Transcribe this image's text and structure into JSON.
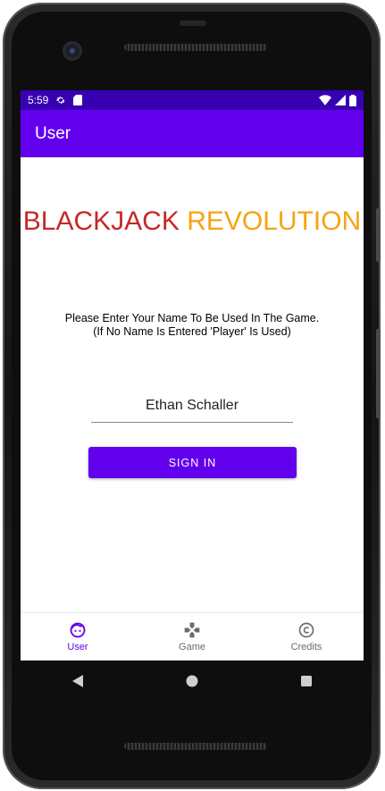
{
  "status_bar": {
    "time": "5:59"
  },
  "app_bar": {
    "title": "User"
  },
  "main": {
    "title_part1": "BLACKJACK",
    "title_part2": "REVOLUTION",
    "instruction_line1": "Please Enter Your Name To Be Used In The Game.",
    "instruction_line2": "(If No Name Is Entered 'Player' Is Used)",
    "name_value": "Ethan Schaller",
    "signin_label": "SIGN IN"
  },
  "bottom_nav": {
    "items": [
      {
        "label": "User",
        "icon": "face-icon",
        "active": true
      },
      {
        "label": "Game",
        "icon": "gamepad-icon",
        "active": false
      },
      {
        "label": "Credits",
        "icon": "copyright-icon",
        "active": false
      }
    ]
  },
  "colors": {
    "primary": "#6200EE",
    "status_bar": "#3700B3",
    "title_red": "#C62828",
    "title_orange": "#F6A313"
  }
}
